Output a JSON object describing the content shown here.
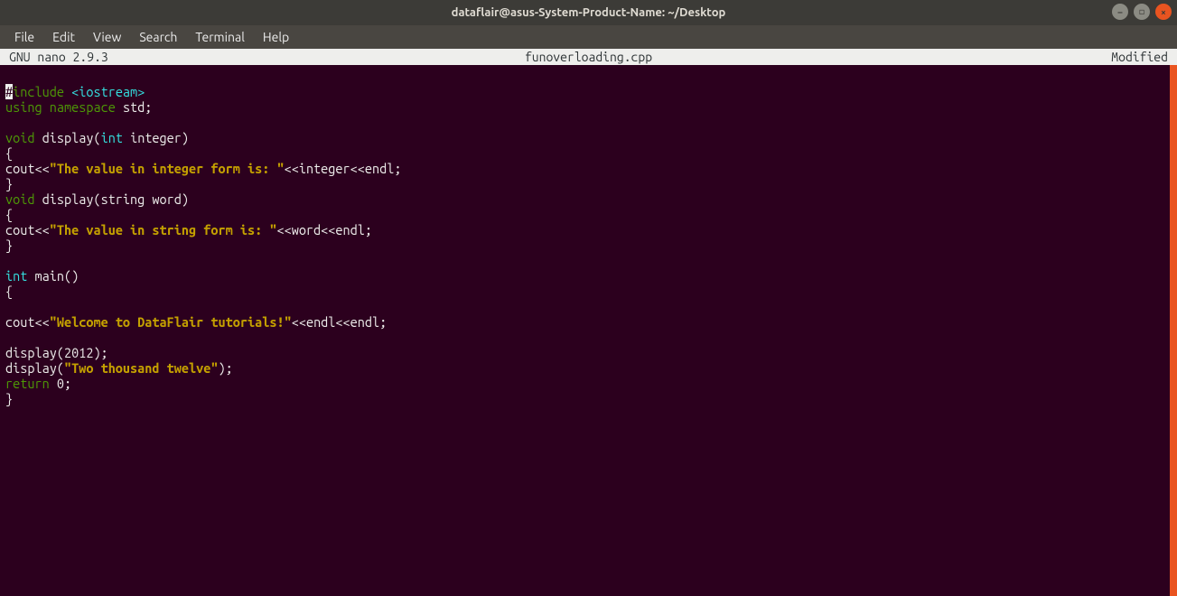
{
  "window": {
    "title": "dataflair@asus-System-Product-Name: ~/Desktop"
  },
  "menu": {
    "file": "File",
    "edit": "Edit",
    "view": "View",
    "search": "Search",
    "terminal": "Terminal",
    "help": "Help"
  },
  "statusbar": {
    "left": "  GNU nano 2.9.3",
    "center": "funoverloading.cpp",
    "right": "Modified  "
  },
  "code": {
    "blank": "",
    "l1_hash": "#",
    "l1_include": "include ",
    "l1_iostream": "<iostream>",
    "l2_using": "using ",
    "l2_namespace": "namespace ",
    "l2_std": "std;",
    "l3_void": "void",
    "l3_display": " display(",
    "l3_int": "int",
    "l3_rest": " integer)",
    "l4_brace_open": "{",
    "l5_cout": "cout<<",
    "l5_str": "\"The value in integer form is: \"",
    "l5_rest": "<<integer<<endl;",
    "l6_brace_close": "}",
    "l7_void": "void",
    "l7_rest1": " display(string word)",
    "l8_brace_open": "{",
    "l9_cout": "cout<<",
    "l9_str": "\"The value in string form is: \"",
    "l9_rest": "<<word<<endl;",
    "l10_brace_close": "}",
    "l11_int": "int",
    "l11_main": " main()",
    "l12_brace_open": "{",
    "l13_cout": "cout<<",
    "l13_str": "\"Welcome to DataFlair tutorials!\"",
    "l13_rest": "<<endl<<endl;",
    "l14_display2012": "display(2012);",
    "l15_display_open": "display(",
    "l15_str": "\"Two thousand twelve\"",
    "l15_close": ");",
    "l16_return": "return",
    "l16_rest": " 0;",
    "l17_brace_close": "}"
  }
}
